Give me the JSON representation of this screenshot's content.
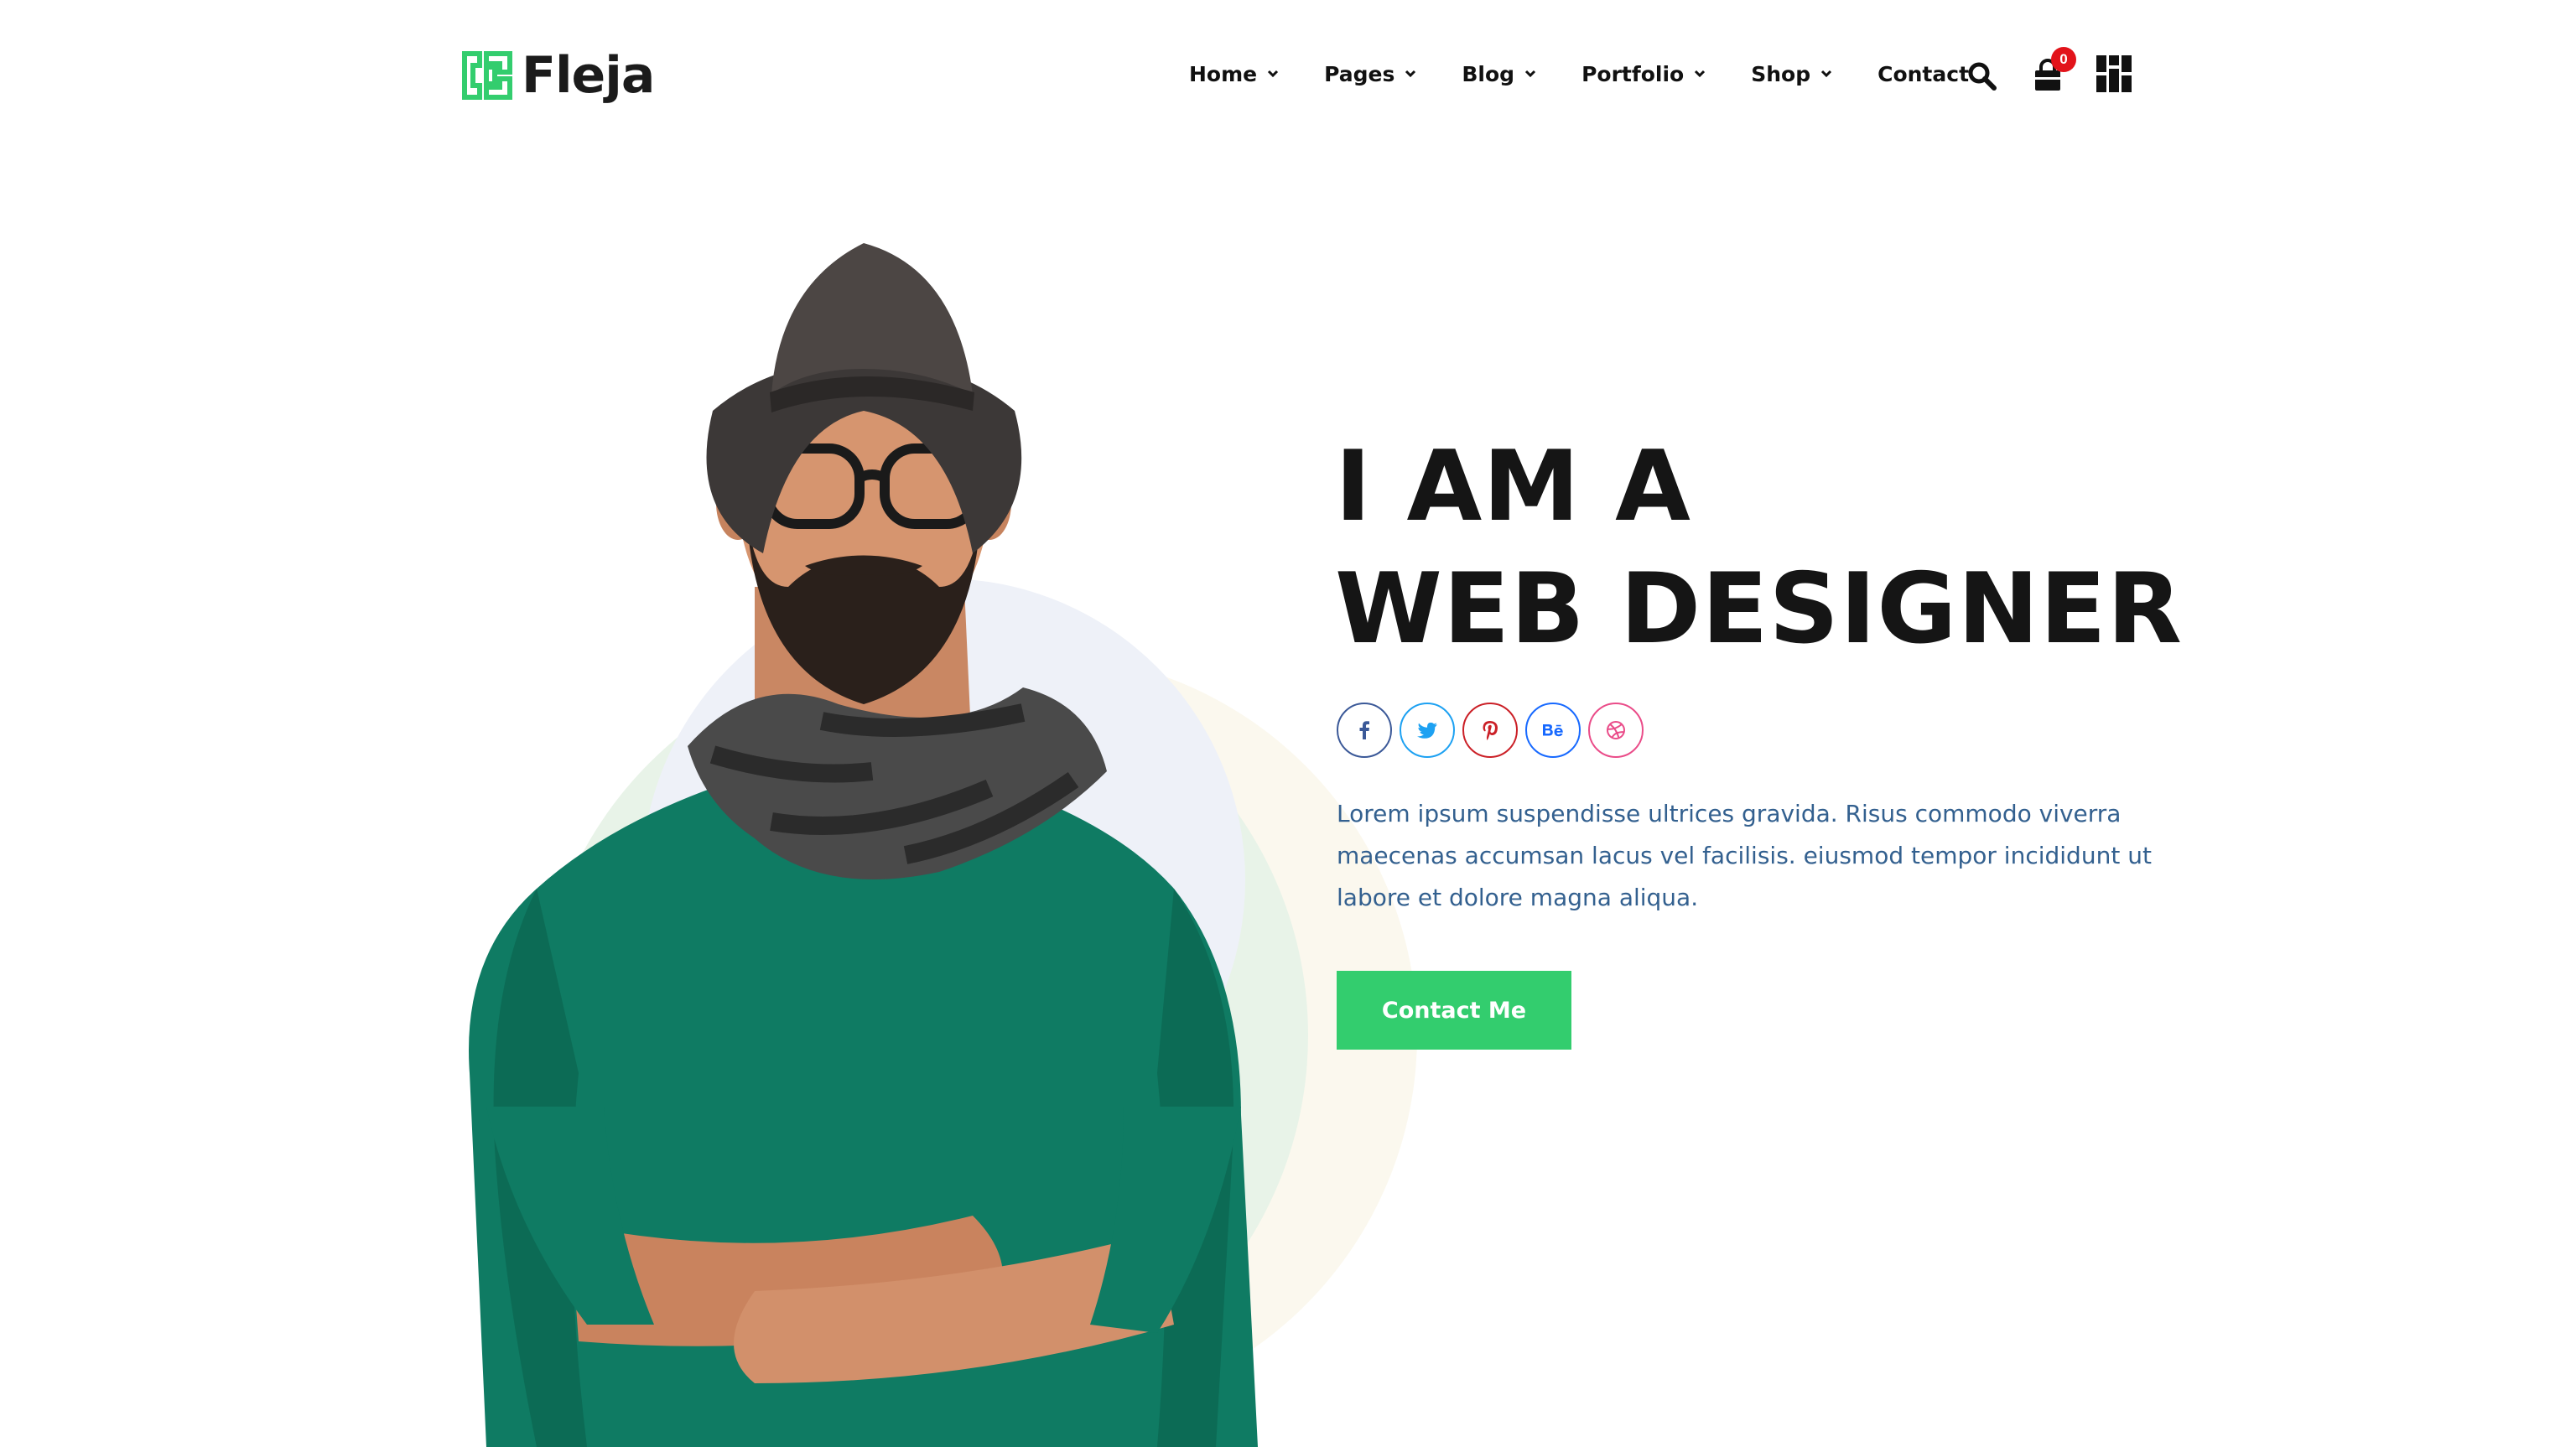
{
  "brand": {
    "name": "Fleja",
    "accent": "#33cd6e",
    "logo_icon": "fleja-logo-mark-icon"
  },
  "nav": {
    "items": [
      {
        "label": "Home",
        "has_dropdown": true
      },
      {
        "label": "Pages",
        "has_dropdown": true
      },
      {
        "label": "Blog",
        "has_dropdown": true
      },
      {
        "label": "Portfolio",
        "has_dropdown": true
      },
      {
        "label": "Shop",
        "has_dropdown": true
      },
      {
        "label": "Contact",
        "has_dropdown": false
      }
    ],
    "search_icon": "search-icon",
    "cart_icon": "shopping-bag-icon",
    "cart_count": "0",
    "cart_badge_color": "#e2131a",
    "menu_icon": "grid-menu-icon"
  },
  "hero": {
    "headline_line1": "I AM A",
    "headline_line2": "WEB DESIGNER",
    "description": "Lorem ipsum suspendisse ultrices gravida. Risus commodo viverra maecenas accumsan lacus vel facilisis. eiusmod tempor incididunt ut labore et dolore magna aliqua.",
    "description_color": "#33608f",
    "cta_label": "Contact Me",
    "image": "man-with-hat-glasses-green-sweater-arms-crossed",
    "socials": [
      {
        "name": "facebook-icon",
        "glyph": "f",
        "color": "#3b5998"
      },
      {
        "name": "twitter-icon",
        "glyph": "twitter",
        "color": "#1da1f2"
      },
      {
        "name": "pinterest-icon",
        "glyph": "p",
        "color": "#cb2027"
      },
      {
        "name": "behance-icon",
        "glyph": "Bē",
        "color": "#1769ff"
      },
      {
        "name": "dribbble-icon",
        "glyph": "dribbble",
        "color": "#ea4c89"
      }
    ]
  }
}
